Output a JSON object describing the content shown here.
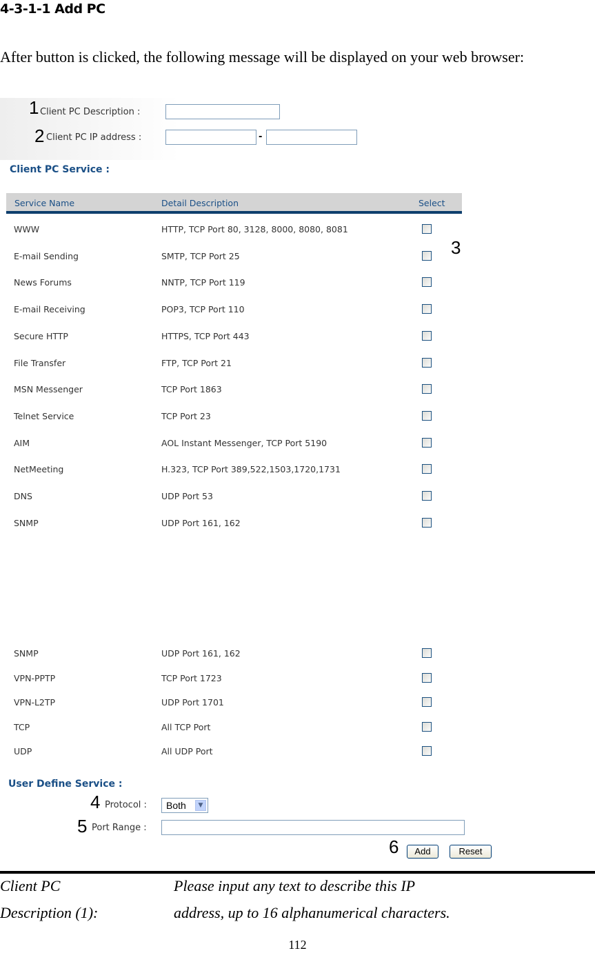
{
  "document": {
    "heading": "4-3-1-1 Add PC",
    "intro": "After button is clicked, the following message will be displayed on your web browser:",
    "page_number": "112"
  },
  "form": {
    "callouts": [
      "1",
      "2",
      "3",
      "4",
      "5",
      "6"
    ],
    "description_label": "Client PC Description :",
    "description_value": "",
    "ip_label": "Client PC IP address :",
    "ip_start_value": "",
    "ip_separator": "-",
    "ip_end_value": "",
    "service_section_title": "Client PC Service :",
    "table_headers": {
      "service_name": "Service Name",
      "detail_description": "Detail Description",
      "select": "Select"
    },
    "services_top": [
      {
        "name": "WWW",
        "description": "HTTP, TCP Port 80, 3128, 8000, 8080, 8081",
        "checked": false
      },
      {
        "name": "E-mail Sending",
        "description": "SMTP, TCP Port 25",
        "checked": false
      },
      {
        "name": "News Forums",
        "description": "NNTP, TCP Port 119",
        "checked": false
      },
      {
        "name": "E-mail Receiving",
        "description": "POP3, TCP Port 110",
        "checked": false
      },
      {
        "name": "Secure HTTP",
        "description": "HTTPS, TCP Port 443",
        "checked": false
      },
      {
        "name": "File Transfer",
        "description": "FTP, TCP Port 21",
        "checked": false
      },
      {
        "name": "MSN Messenger",
        "description": "TCP Port 1863",
        "checked": false
      },
      {
        "name": "Telnet Service",
        "description": "TCP Port 23",
        "checked": false
      },
      {
        "name": "AIM",
        "description": "AOL Instant Messenger, TCP Port 5190",
        "checked": false
      },
      {
        "name": "NetMeeting",
        "description": "H.323, TCP Port 389,522,1503,1720,1731",
        "checked": false
      },
      {
        "name": "DNS",
        "description": "UDP Port 53",
        "checked": false
      },
      {
        "name": "SNMP",
        "description": "UDP Port 161, 162",
        "checked": false
      }
    ],
    "services_bottom": [
      {
        "name": "SNMP",
        "description": "UDP Port 161, 162",
        "checked": false
      },
      {
        "name": "VPN-PPTP",
        "description": "TCP Port 1723",
        "checked": false
      },
      {
        "name": "VPN-L2TP",
        "description": "UDP Port 1701",
        "checked": false
      },
      {
        "name": "TCP",
        "description": "All TCP Port",
        "checked": false
      },
      {
        "name": "UDP",
        "description": "All UDP Port",
        "checked": false
      }
    ],
    "user_define_title": "User Define Service :",
    "protocol_label": "Protocol :",
    "protocol_value": "Both",
    "port_range_label": "Port Range :",
    "port_range_value": "",
    "add_button": "Add",
    "reset_button": "Reset"
  },
  "definition": {
    "term_line1": "Client PC",
    "term_line2": "Description (1):",
    "desc_line1": "Please input any text to describe this IP",
    "desc_line2": "address, up to 16 alphanumerical characters."
  }
}
